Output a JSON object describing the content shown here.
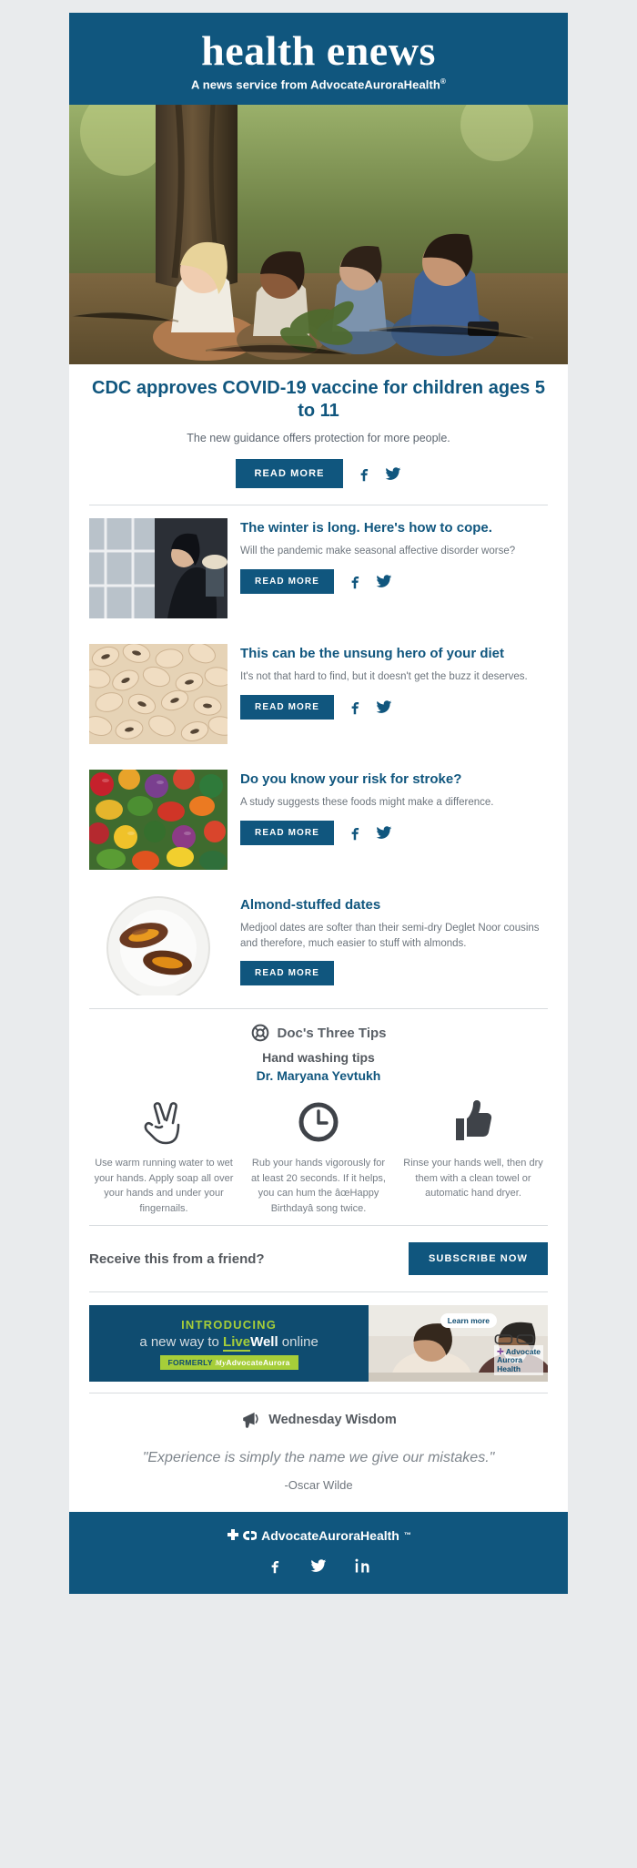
{
  "masthead": {
    "title": "health enews",
    "subtitle_prefix": "A news service from ",
    "brand": "AdvocateAuroraHealth",
    "tm": "®"
  },
  "hero": {
    "title": "CDC approves COVID-19 vaccine for children ages 5 to 11",
    "subtitle": "The new guidance offers protection for more people.",
    "read_more": "READ MORE",
    "facebook_icon": "facebook-icon",
    "twitter_icon": "twitter-icon"
  },
  "articles": [
    {
      "title": "The winter is long. Here's how to cope.",
      "description": "Will the pandemic make seasonal affective disorder worse?",
      "read_more": "READ MORE",
      "has_social": true,
      "thumb": "woman-looking-out-window",
      "round": false
    },
    {
      "title": "This can be the unsung hero of your diet",
      "description": "It's not that hard to find, but it doesn't get the buzz it deserves.",
      "read_more": "READ MORE",
      "has_social": true,
      "thumb": "black-eyed-peas-beans",
      "round": false
    },
    {
      "title": "Do you know your risk for stroke?",
      "description": "A study suggests these foods might make a difference.",
      "read_more": "READ MORE",
      "has_social": true,
      "thumb": "colorful-vegetables",
      "round": false
    },
    {
      "title": "Almond-stuffed dates",
      "description": "Medjool dates are softer than their semi-dry Deglet Noor cousins and therefore, much easier to stuff with almonds.",
      "read_more": "READ MORE",
      "has_social": false,
      "thumb": "almond-stuffed-dates-plate",
      "round": true
    }
  ],
  "tips": {
    "header": "Doc's Three Tips",
    "header_icon": "life-ring-icon",
    "subject": "Hand washing tips",
    "doctor": "Dr. Maryana Yevtukh",
    "items": [
      {
        "icon": "victory-hand-icon",
        "text": "Use warm running water to wet your hands. Apply soap all over your hands and under your fingernails."
      },
      {
        "icon": "clock-icon",
        "text": "Rub your hands vigorously for at least 20 seconds. If it helps, you can hum the âœHappy Birthdayâ song twice."
      },
      {
        "icon": "thumbs-up-icon",
        "text": "Rinse your hands well, then dry them with a clean towel or automatic hand dryer."
      }
    ]
  },
  "subscribe": {
    "label": "Receive this from a friend?",
    "button": "SUBSCRIBE NOW"
  },
  "promo": {
    "introducing": "INTRODUCING",
    "line2_prefix": "a new way to ",
    "live": "Live",
    "well": "Well",
    "line2_suffix": " online",
    "formerly_label": "FORMERLY",
    "formerly_my": "My",
    "formerly_brand": "AdvocateAurora",
    "learn_more": "Learn more",
    "logo_line1": "Advocate",
    "logo_line2": "Aurora",
    "logo_line3": "Health"
  },
  "wisdom": {
    "header": "Wednesday Wisdom",
    "header_icon": "megaphone-icon",
    "quote": "\"Experience is simply the name we give our mistakes.\"",
    "author": "-Oscar Wilde"
  },
  "footer": {
    "brand": "AdvocateAuroraHealth",
    "tm": "™",
    "social": [
      "facebook-icon",
      "twitter-icon",
      "linkedin-icon"
    ]
  },
  "colors": {
    "brand_blue": "#10567e",
    "promo_blue": "#0f4c70",
    "accent_green": "#a6ce39",
    "body_gray": "#6d757d",
    "page_bg": "#e9ebed"
  }
}
